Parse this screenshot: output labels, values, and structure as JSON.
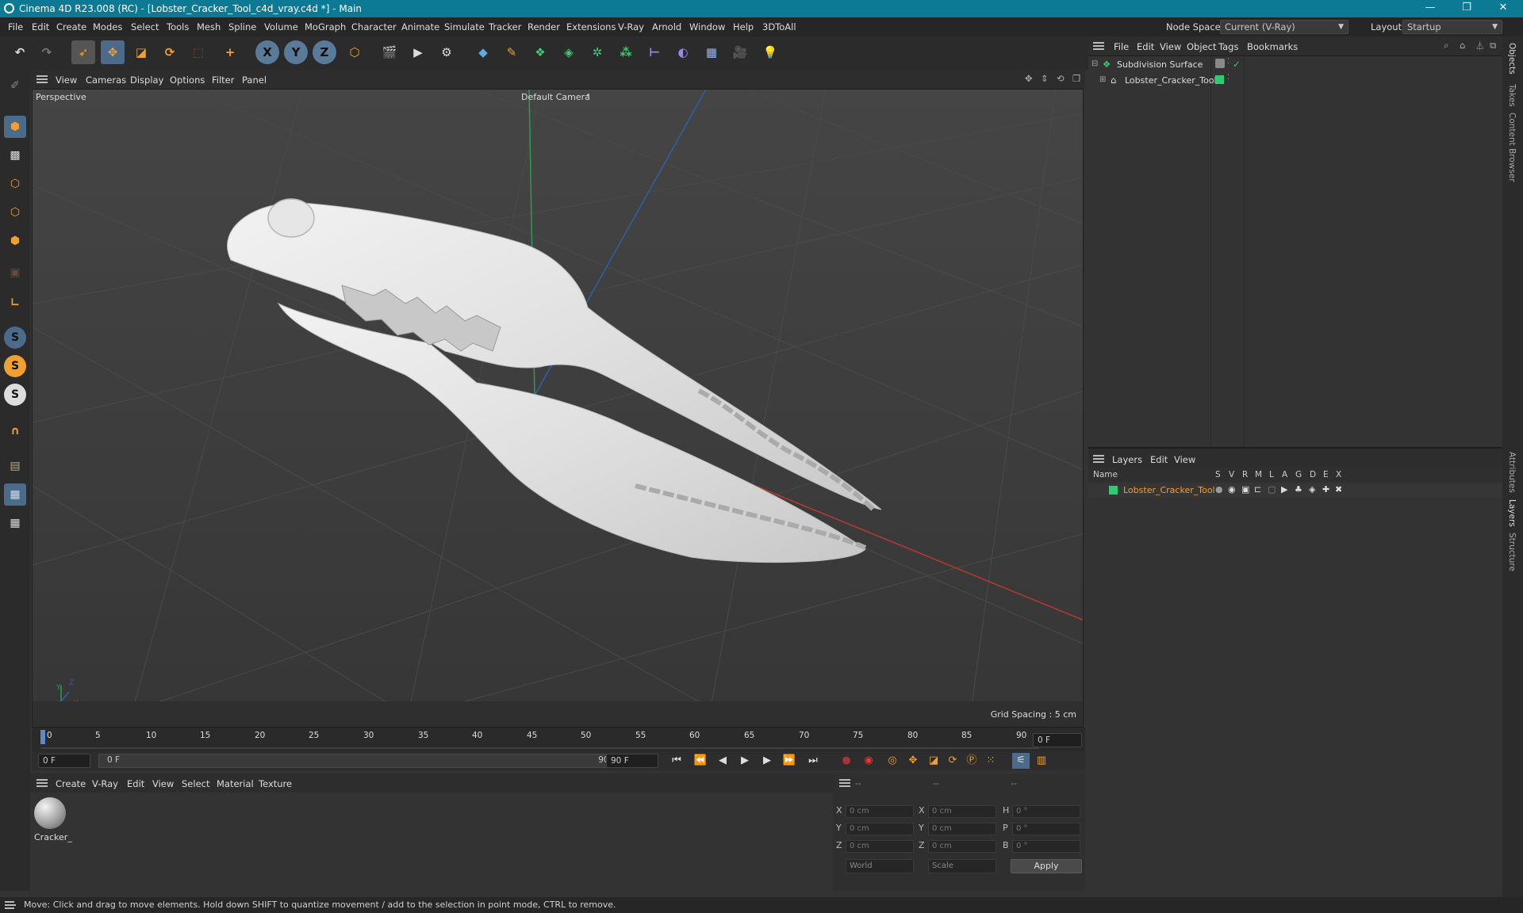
{
  "app": {
    "title": "Cinema 4D R23.008 (RC) - [Lobster_Cracker_Tool_c4d_vray.c4d *] - Main"
  },
  "window_controls": {
    "minimize": "—",
    "maximize": "❐",
    "close": "✕"
  },
  "menubar": {
    "items": [
      "File",
      "Edit",
      "Create",
      "Modes",
      "Select",
      "Tools",
      "Mesh",
      "Spline",
      "Volume",
      "MoGraph",
      "Character",
      "Animate",
      "Simulate",
      "Tracker",
      "Render",
      "Extensions",
      "V-Ray",
      "Arnold",
      "Window",
      "Help",
      "3DToAll"
    ],
    "node_space_label": "Node Space:",
    "node_space_value": "Current (V-Ray)",
    "layout_label": "Layout:",
    "layout_value": "Startup"
  },
  "toolbar": {
    "x_label": "X",
    "y_label": "Y",
    "z_label": "Z"
  },
  "left_toolbar": {
    "s1": "S",
    "s2": "S",
    "s3": "S"
  },
  "viewport": {
    "menu": [
      "View",
      "Cameras",
      "Display",
      "Options",
      "Filter",
      "Panel"
    ],
    "view_name": "Perspective",
    "camera": "Default Camera",
    "grid_spacing": "Grid Spacing : 5 cm",
    "axis_x": "X",
    "axis_y": "Y",
    "axis_z": "Z"
  },
  "timeline": {
    "ticks": [
      "0",
      "5",
      "10",
      "15",
      "20",
      "25",
      "30",
      "35",
      "40",
      "45",
      "50",
      "55",
      "60",
      "65",
      "70",
      "75",
      "80",
      "85",
      "90"
    ],
    "current_frame": "0 F"
  },
  "transport": {
    "start_field": "0 F",
    "range_start": "0 F",
    "range_end": "90 F",
    "end_field": "90 F"
  },
  "material_panel": {
    "menu": [
      "Create",
      "V-Ray",
      "Edit",
      "View",
      "Select",
      "Material",
      "Texture"
    ],
    "materials": [
      {
        "name": "Cracker_"
      }
    ]
  },
  "coordinates": {
    "headers": [
      "--",
      "--",
      "--"
    ],
    "rows": [
      {
        "l1": "X",
        "v1": "0 cm",
        "l2": "X",
        "v2": "0 cm",
        "l3": "H",
        "v3": "0 °"
      },
      {
        "l1": "Y",
        "v1": "0 cm",
        "l2": "Y",
        "v2": "0 cm",
        "l3": "P",
        "v3": "0 °"
      },
      {
        "l1": "Z",
        "v1": "0 cm",
        "l2": "Z",
        "v2": "0 cm",
        "l3": "B",
        "v3": "0 °"
      }
    ],
    "space": "World",
    "mode": "Scale",
    "apply": "Apply"
  },
  "object_manager": {
    "menu": [
      "File",
      "Edit",
      "View",
      "Object",
      "Tags",
      "Bookmarks"
    ],
    "objects": [
      {
        "name": "Subdivision Surface"
      },
      {
        "name": "Lobster_Cracker_Tool"
      }
    ]
  },
  "layer_manager": {
    "menu": [
      "Layers",
      "Edit",
      "View"
    ],
    "columns": [
      "Name",
      "S",
      "V",
      "R",
      "M",
      "L",
      "A",
      "G",
      "D",
      "E",
      "X"
    ],
    "layers": [
      {
        "name": "Lobster_Cracker_Tool"
      }
    ]
  },
  "side_tabs": [
    "Objects",
    "Takes",
    "Content Browser",
    "Attributes",
    "Layers",
    "Structure"
  ],
  "status": {
    "text": "Move: Click and drag to move elements. Hold down SHIFT to quantize movement / add to the selection in point mode, CTRL to remove."
  },
  "colors": {
    "titlebar": "#0d7a95",
    "accent_orange": "#f0a030",
    "layer_green": "#2ecc71",
    "axis_x": "#c0392b",
    "axis_y": "#27ae60",
    "axis_z": "#2e5fa8"
  }
}
